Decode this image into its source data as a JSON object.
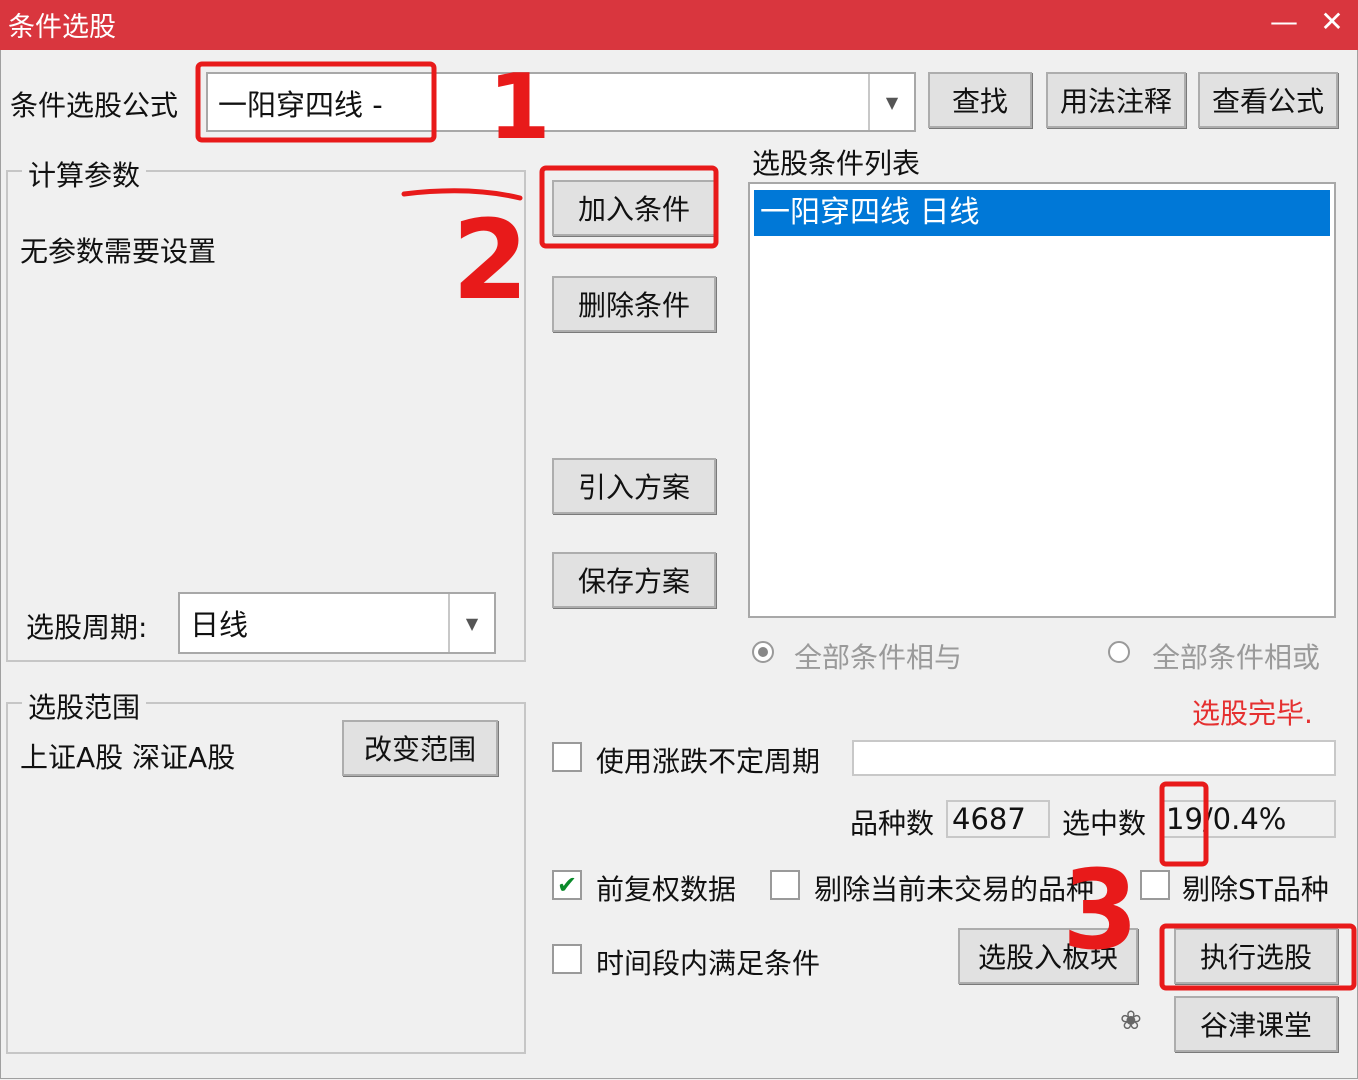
{
  "window": {
    "title": "条件选股",
    "minimize_icon": "—",
    "close_icon": "✕"
  },
  "formula": {
    "label": "条件选股公式",
    "value": "一阳穿四线   -"
  },
  "buttons": {
    "find": "查找",
    "usage": "用法注释",
    "view_formula": "查看公式",
    "add_condition": "加入条件",
    "delete_condition": "删除条件",
    "import_plan": "引入方案",
    "save_plan": "保存方案",
    "change_range": "改变范围",
    "to_block": "选股入板块",
    "execute": "执行选股",
    "bottom": "谷津课堂"
  },
  "params": {
    "title": "计算参数",
    "message": "无参数需要设置",
    "period_label": "选股周期:",
    "period_value": "日线"
  },
  "condition_list": {
    "title": "选股条件列表",
    "items": [
      "一阳穿四线  日线"
    ]
  },
  "logic": {
    "and_label": "全部条件相与",
    "or_label": "全部条件相或",
    "selected": "and"
  },
  "range": {
    "title": "选股范围",
    "value": "上证A股 深证A股"
  },
  "status": "选股完毕.",
  "options": {
    "use_period_label": "使用涨跌不定周期",
    "use_period_checked": false,
    "use_period_value": "",
    "forward_adjust_label": "前复权数据",
    "forward_adjust_checked": true,
    "exclude_untraded_label": "剔除当前未交易的品种",
    "exclude_untraded_checked": false,
    "exclude_st_label": "剔除ST品种",
    "exclude_st_checked": false,
    "time_range_label": "时间段内满足条件",
    "time_range_checked": false
  },
  "stats": {
    "count_label": "品种数",
    "count_value": "4687",
    "selected_label": "选中数",
    "selected_value": "19/0.4%"
  },
  "annotations": {
    "mark1": "1",
    "mark2": "2",
    "mark3": "3"
  },
  "colors": {
    "title_bar": "#d9363e",
    "selection": "#0078d7",
    "annotation": "#e81a1a",
    "status": "#e53030"
  }
}
